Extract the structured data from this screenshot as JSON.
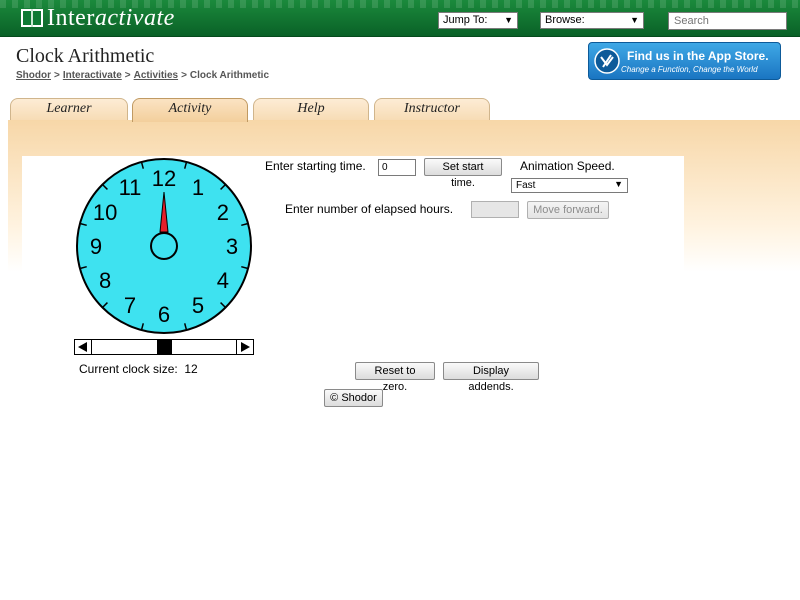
{
  "header": {
    "logo_prefix": "Inter",
    "logo_suffix": "activate",
    "jump_to": "Jump To:",
    "browse": "Browse:",
    "search_placeholder": "Search"
  },
  "page": {
    "title": "Clock Arithmetic",
    "breadcrumb": [
      "Shodor",
      "Interactivate",
      "Activities",
      "Clock Arithmetic"
    ],
    "breadcrumb_sep": ">"
  },
  "appstore": {
    "line1": "Find us in the App Store.",
    "line2": "Change a Function, Change the World"
  },
  "tabs": [
    {
      "label": "Learner",
      "active": false
    },
    {
      "label": "Activity",
      "active": true
    },
    {
      "label": "Help",
      "active": false
    },
    {
      "label": "Instructor",
      "active": false
    }
  ],
  "applet": {
    "clock_numbers": [
      "12",
      "1",
      "2",
      "3",
      "4",
      "5",
      "6",
      "7",
      "8",
      "9",
      "10",
      "11"
    ],
    "clock_size_label": "Current clock size:",
    "clock_size_value": "12",
    "clock_size_fraction": 0.5,
    "start_time_label": "Enter starting time.",
    "start_time_value": "0",
    "set_start_button": "Set start time.",
    "animation_speed_label": "Animation Speed.",
    "animation_speed_value": "Fast",
    "elapsed_label": "Enter number of elapsed hours.",
    "move_forward_button": "Move forward.",
    "reset_button": "Reset to zero.",
    "display_addends_button": "Display addends.",
    "copyright_button": "© Shodor",
    "hand_value": 0
  },
  "colors": {
    "clock_face": "#3ee2f0",
    "hand": "#e4202a",
    "header_green": "#0e7a33"
  }
}
